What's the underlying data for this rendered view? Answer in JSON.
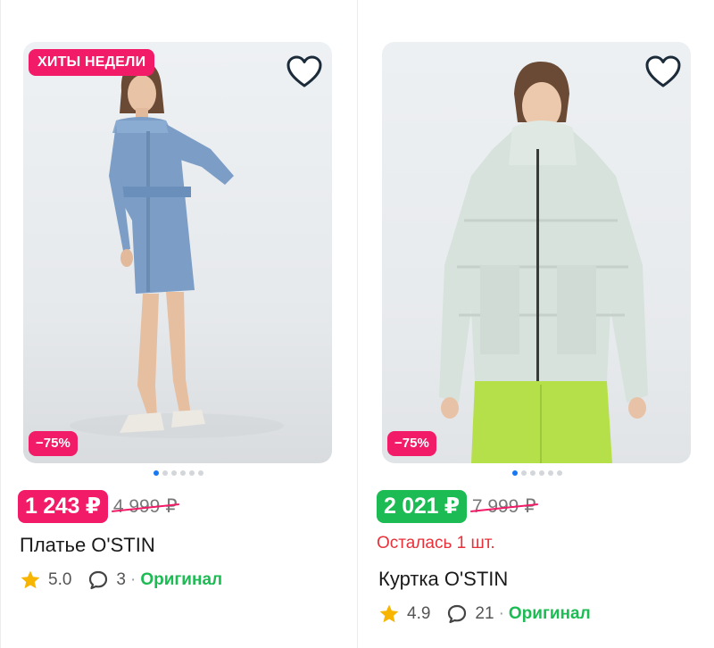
{
  "colors": {
    "accent_pink": "#f21b67",
    "accent_green": "#1cbb53",
    "star": "#f7b500",
    "dot_active": "#1877f2",
    "stock_red": "#e8313a"
  },
  "products": [
    {
      "hit_badge": "ХИТЫ НЕДЕЛИ",
      "discount": "−75%",
      "price": "1 243 ₽",
      "old_price": "4 999 ₽",
      "stock_note": "",
      "title": "Платье O'STIN",
      "rating": "5.0",
      "reviews": "3",
      "original_label": "Оригинал",
      "image_dots_total": 6,
      "image_dots_active": 1,
      "icons": [
        "heart-icon",
        "star-icon",
        "chat-bubble-icon"
      ]
    },
    {
      "hit_badge": "",
      "discount": "−75%",
      "price": "2 021 ₽",
      "old_price": "7 999 ₽",
      "stock_note": "Осталась 1 шт.",
      "title": "Куртка O'STIN",
      "rating": "4.9",
      "reviews": "21",
      "original_label": "Оригинал",
      "image_dots_total": 6,
      "image_dots_active": 1,
      "icons": [
        "heart-icon",
        "star-icon",
        "chat-bubble-icon"
      ]
    }
  ],
  "separator": "·"
}
